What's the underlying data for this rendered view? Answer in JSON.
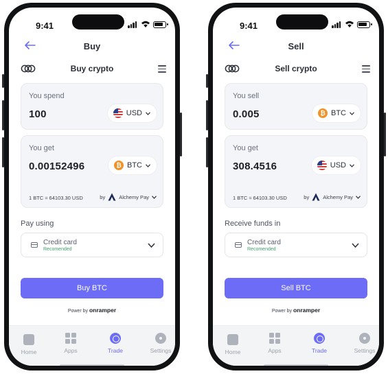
{
  "status": {
    "time": "9:41"
  },
  "buy": {
    "nav_title": "Buy",
    "subtitle": "Buy crypto",
    "spend_label": "You spend",
    "spend_amount": "100",
    "spend_currency": "USD",
    "get_label": "You get",
    "get_amount": "0.00152496",
    "get_currency": "BTC",
    "rate": "1 BTC ≈ 64103.30 USD",
    "provider_prefix": "by",
    "provider_name": "Alchemy Pay",
    "payment_label": "Pay using",
    "payment_method": "Credit card",
    "payment_tag": "Recomended",
    "cta": "Buy BTC",
    "powered_by": "Power by",
    "powered_brand": "onramper"
  },
  "sell": {
    "nav_title": "Sell",
    "subtitle": "Sell crypto",
    "spend_label": "You sell",
    "spend_amount": "0.005",
    "spend_currency": "BTC",
    "get_label": "You get",
    "get_amount": "308.4516",
    "get_currency": "USD",
    "rate": "1 BTC ≈ 64103.30 USD",
    "provider_prefix": "by",
    "provider_name": "Alchemy Pay",
    "payment_label": "Receive funds in",
    "payment_method": "Credit card",
    "payment_tag": "Recomended",
    "cta": "Sell BTC",
    "powered_by": "Power by",
    "powered_brand": "onramper"
  },
  "tabs": [
    {
      "label": "Home",
      "icon": "home-icon",
      "active": false
    },
    {
      "label": "Apps",
      "icon": "apps-icon",
      "active": false
    },
    {
      "label": "Trade",
      "icon": "trade-icon",
      "active": true
    },
    {
      "label": "Settings",
      "icon": "gear-icon",
      "active": false
    }
  ],
  "colors": {
    "accent": "#6c6cf7",
    "bitcoin": "#f0932b",
    "recommended": "#3ea36a"
  }
}
